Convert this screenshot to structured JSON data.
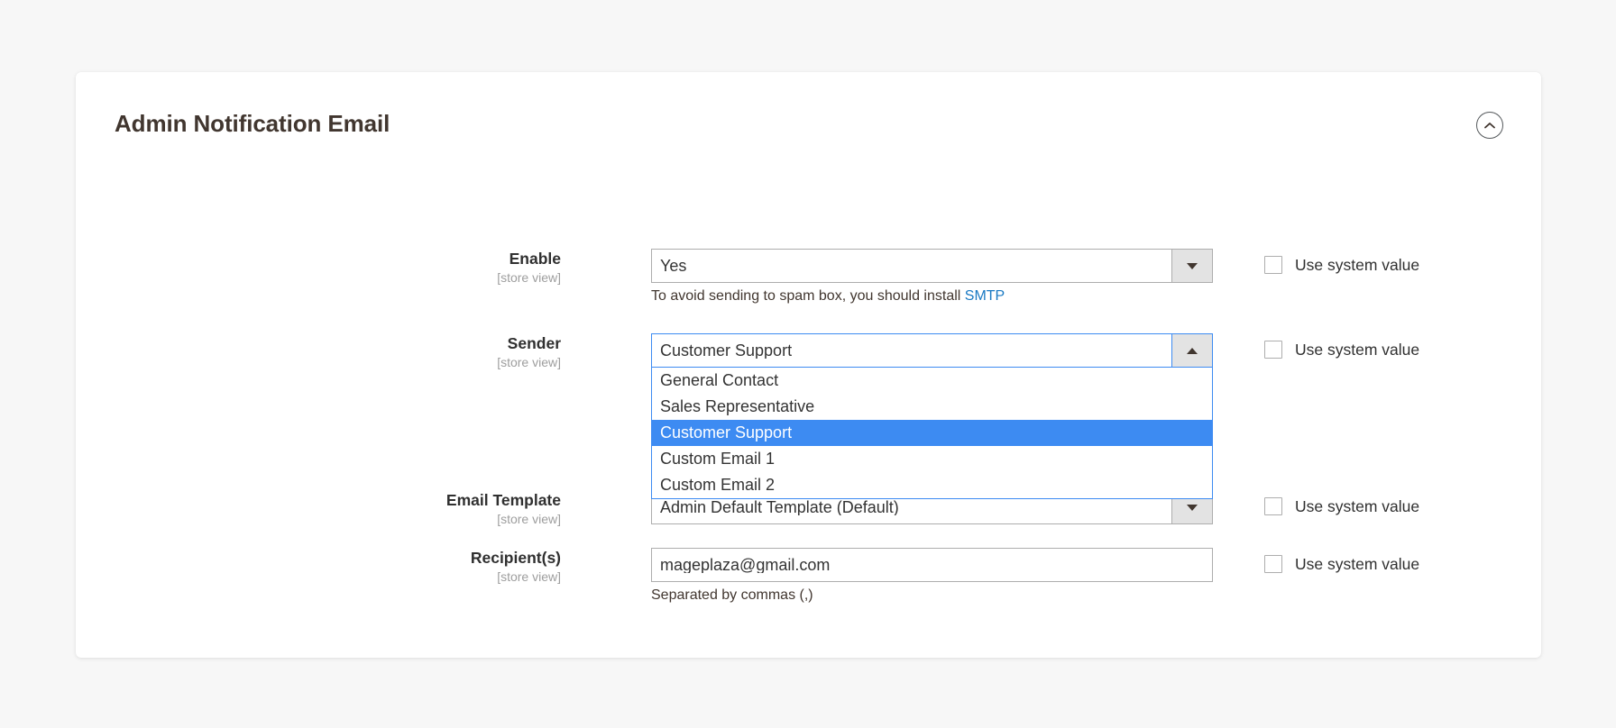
{
  "section": {
    "title": "Admin Notification Email",
    "collapse_icon": "chevron-up-circle-icon",
    "collapsed": false
  },
  "system_value_label": "Use system value",
  "colors": {
    "page_background": "#f7f7f7",
    "card_background": "#ffffff",
    "title_text": "#41362f",
    "label_text": "#303030",
    "scope_text": "#9e9e9e",
    "input_border": "#adadad",
    "focus_border": "#3d8bf2",
    "option_highlight": "#3d8bf2",
    "link_blue": "#1979c3",
    "select_toggle_background": "#e3e3e3"
  },
  "fields": [
    {
      "id": "enable",
      "label": "Enable",
      "scope": "[store view]",
      "type": "select",
      "value": "Yes",
      "open": false,
      "caret": "caret-down",
      "hint_prefix": "To avoid sending to spam box, you should install ",
      "hint_link": "SMTP",
      "use_system_value": false
    },
    {
      "id": "sender",
      "label": "Sender",
      "scope": "[store view]",
      "type": "select",
      "value": "Customer Support",
      "open": true,
      "caret": "caret-up",
      "options": [
        "General Contact",
        "Sales Representative",
        "Customer Support",
        "Custom Email 1",
        "Custom Email 2"
      ],
      "selected_option": "Customer Support",
      "use_system_value": false
    },
    {
      "id": "email-template",
      "label": "Email Template",
      "scope": "[store view]",
      "type": "select",
      "value": "Admin Default Template (Default)",
      "open": false,
      "caret": "caret-down",
      "use_system_value": false
    },
    {
      "id": "recipients",
      "label": "Recipient(s)",
      "scope": "[store view]",
      "type": "text",
      "value": "mageplaza@gmail.com",
      "placeholder": "",
      "hint_prefix": "Separated by commas (,)",
      "use_system_value": false
    }
  ]
}
